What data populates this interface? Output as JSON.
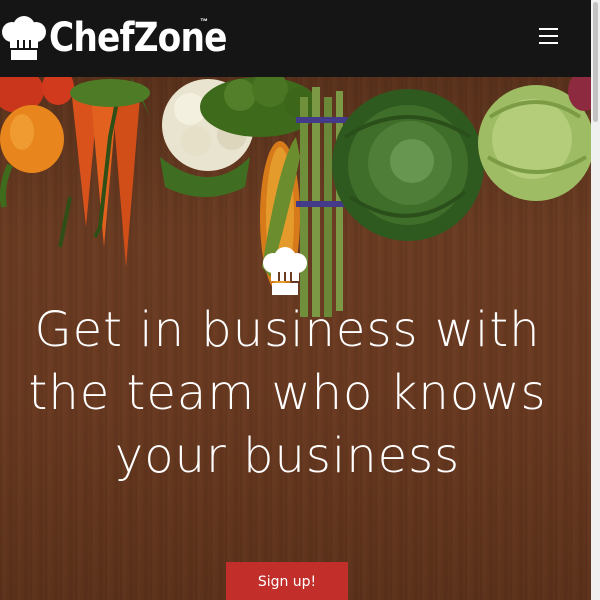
{
  "header": {
    "brand": "ChefZone",
    "trademark": "™",
    "logo_icon": "chef-hat-icon",
    "menu_icon": "hamburger-menu-icon"
  },
  "hero": {
    "icon": "chef-hat-icon",
    "headline": "Get in business with the team who knows your business",
    "cta_label": "Sign up!"
  },
  "colors": {
    "header_bg": "#151515",
    "cta_bg": "#c22f2b",
    "wood": "#6b3c22",
    "text": "#ffffff"
  }
}
